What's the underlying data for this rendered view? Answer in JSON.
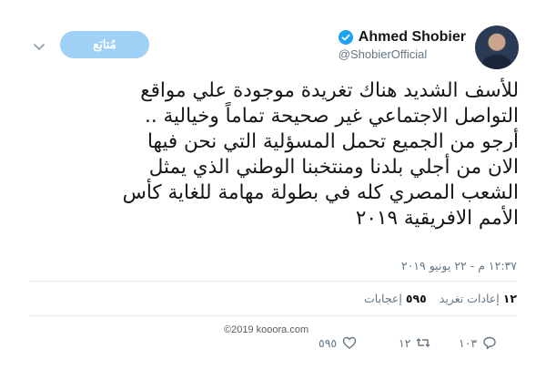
{
  "header": {
    "display_name": "Ahmed Shobier",
    "handle": "@ShobierOfficial",
    "follow_label": "مُتابَع",
    "verified_icon": "verified-badge-icon",
    "menu_icon": "chevron-down-icon",
    "accent": "#1da1f2"
  },
  "tweet": {
    "lines": [
      "للأسف الشديد هناك تغريدة موجودة علي مواقع",
      "التواصل الاجتماعي غير صحيحة تماماً وخيالية ..",
      "أرجو من الجميع تحمل المسؤلية التي نحن فيها",
      "الان من أجلي بلدنا ومنتخبنا الوطني الذي يمثل",
      "الشعب المصري كله في بطولة مهامة للغاية كأس",
      "الأمم الافريقية ٢٠١٩"
    ],
    "timestamp": "١٢:٣٧ م - ٢٢ يونيو ٢٠١٩"
  },
  "stats": {
    "retweets_count": "١٢",
    "retweets_label": "إعادات تغريد",
    "likes_count": "٥٩٥",
    "likes_label": "إعجابات"
  },
  "actions": {
    "reply_count": "١٠٣",
    "retweet_count": "١٢",
    "like_count": "٥٩٥"
  },
  "watermark": "©2019 kooora.com"
}
